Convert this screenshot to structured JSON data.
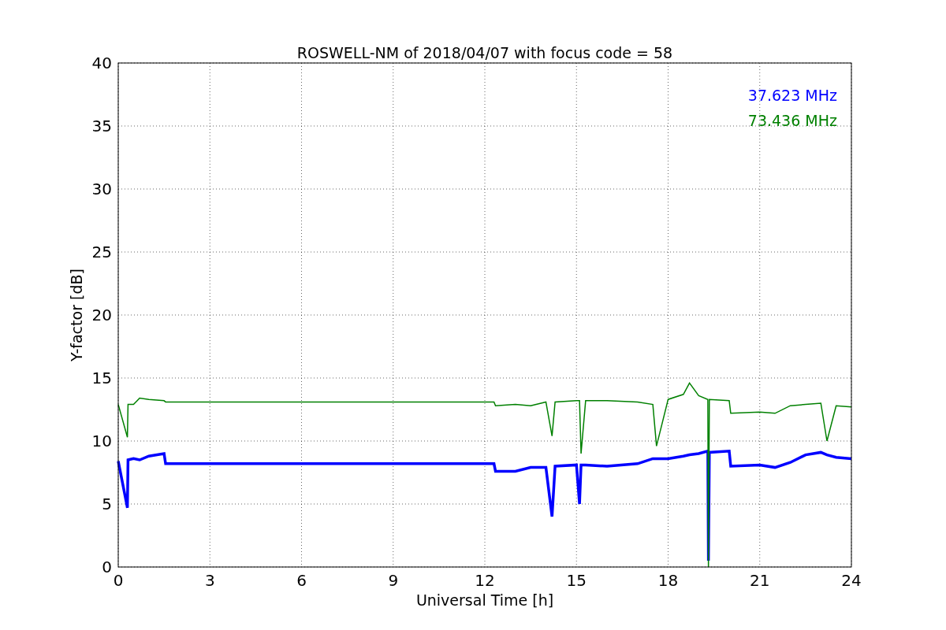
{
  "chart": {
    "chart_data": {
      "type": "line",
      "title": "ROSWELL-NM of 2018/04/07 with focus code = 58",
      "xlabel": "Universal Time [h]",
      "ylabel": "Y-factor [dB]",
      "x": [
        0,
        0.3,
        0.32,
        0.5,
        0.7,
        1,
        1.5,
        1.55,
        12.3,
        12.35,
        13,
        13.5,
        14,
        14.2,
        14.3,
        15,
        15.1,
        15.15,
        15.3,
        16,
        17,
        17.5,
        17.62,
        18,
        18.5,
        18.7,
        19,
        19.3,
        19.32,
        19.35,
        20,
        20.05,
        21,
        21.5,
        22,
        22.5,
        23,
        23.2,
        23.5,
        24
      ],
      "series": [
        {
          "name": "37.623 MHz",
          "color": "#0000ff",
          "values": [
            8.4,
            4.7,
            8.5,
            8.6,
            8.5,
            8.8,
            9.0,
            8.2,
            8.2,
            7.6,
            7.6,
            7.9,
            7.9,
            4.0,
            8.0,
            8.1,
            5.0,
            8.1,
            8.1,
            8.0,
            8.2,
            8.6,
            8.6,
            8.6,
            8.8,
            8.9,
            9.0,
            9.2,
            0.5,
            9.1,
            9.2,
            8.0,
            8.1,
            7.9,
            8.3,
            8.9,
            9.1,
            8.9,
            8.7,
            8.6
          ]
        },
        {
          "name": "73.436 MHz",
          "color": "#008000",
          "values": [
            12.9,
            10.3,
            12.9,
            12.9,
            13.4,
            13.3,
            13.2,
            13.1,
            13.1,
            12.8,
            12.9,
            12.8,
            13.1,
            10.4,
            13.1,
            13.2,
            13.2,
            9.0,
            13.2,
            13.2,
            13.1,
            12.9,
            9.6,
            13.3,
            13.7,
            14.6,
            13.6,
            13.3,
            0,
            13.3,
            13.2,
            12.2,
            12.3,
            12.2,
            12.8,
            12.9,
            13.0,
            10.0,
            12.8,
            12.7
          ]
        }
      ],
      "grid": true,
      "xlim": [
        0,
        24
      ],
      "ylim": [
        0,
        40
      ],
      "xticks": [
        0,
        3,
        6,
        9,
        12,
        15,
        18,
        21,
        24
      ],
      "yticks": [
        0,
        5,
        10,
        15,
        20,
        25,
        30,
        35,
        40
      ]
    }
  }
}
